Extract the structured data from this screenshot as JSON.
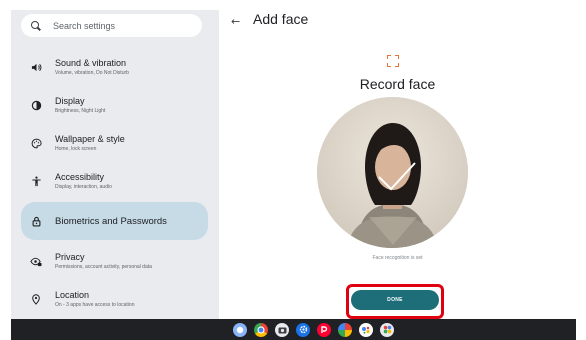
{
  "search": {
    "placeholder": "Search settings"
  },
  "sidebar": {
    "items": [
      {
        "title": "Sound & vibration",
        "subtitle": "Volume, vibration, Do Not Disturb",
        "icon": "speaker-icon"
      },
      {
        "title": "Display",
        "subtitle": "Brightness, Night Light",
        "icon": "display-icon"
      },
      {
        "title": "Wallpaper & style",
        "subtitle": "Home, lock screen",
        "icon": "palette-icon"
      },
      {
        "title": "Accessibility",
        "subtitle": "Display, interaction, audio",
        "icon": "accessibility-icon"
      },
      {
        "title": "Biometrics and Passwords",
        "subtitle": "",
        "icon": "lock-icon",
        "active": true
      },
      {
        "title": "Privacy",
        "subtitle": "Permissions, account activity, personal data",
        "icon": "privacy-icon"
      },
      {
        "title": "Location",
        "subtitle": "On - 3 apps have access to location",
        "icon": "location-pin-icon"
      }
    ]
  },
  "header": {
    "title": "Add face"
  },
  "main": {
    "record_title": "Record face",
    "status_text": "Face recognition is set",
    "done_label": "DONE"
  },
  "colors": {
    "accent": "#1d6e79",
    "highlight": "#e1000f",
    "active_nav": "#c6dbe6"
  },
  "shelf": {
    "apps": [
      "launcher-icon",
      "chrome-icon",
      "camera-icon",
      "settings-app-icon",
      "paypay-icon",
      "photos-icon",
      "assistant-icon",
      "more-apps-icon"
    ]
  }
}
